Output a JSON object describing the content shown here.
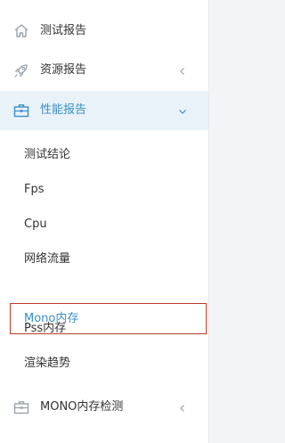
{
  "colors": {
    "active_text": "#3a8fc7",
    "active_bg": "#e9f2f9",
    "icon_gray": "#9aa3ab",
    "selected_border": "#c0392b"
  },
  "menu": {
    "items": [
      {
        "label": "测试报告",
        "icon": "home-icon",
        "arrow": null
      },
      {
        "label": "资源报告",
        "icon": "rocket-icon",
        "arrow": "chevron-left-icon"
      },
      {
        "label": "性能报告",
        "icon": "toolbox-icon",
        "arrow": "chevron-down-icon",
        "expanded": true
      },
      {
        "label": "MONO内存检测",
        "icon": "toolbox-icon",
        "arrow": "chevron-left-icon"
      }
    ],
    "perf_submenu": [
      {
        "label": "测试结论"
      },
      {
        "label": "Fps"
      },
      {
        "label": "Cpu"
      },
      {
        "label": "网络流量"
      },
      {
        "label": "Mono内存",
        "selected": true
      },
      {
        "label": "Pss内存"
      },
      {
        "label": "渲染趋势"
      }
    ]
  }
}
